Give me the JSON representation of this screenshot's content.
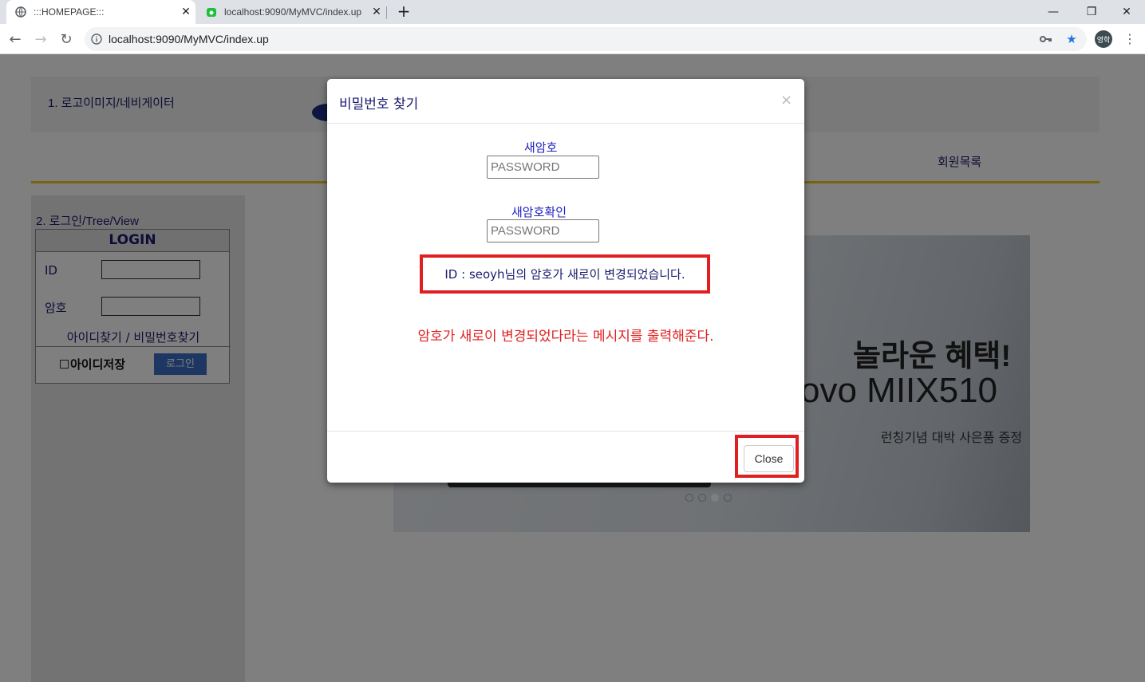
{
  "browser": {
    "tabs": [
      {
        "title": ":::HOMEPAGE:::",
        "active": true
      },
      {
        "title": "localhost:9090/MyMVC/index.up",
        "active": false
      }
    ],
    "url": "localhost:9090/MyMVC/index.up",
    "profile_initials": "영학"
  },
  "page": {
    "header_label": "1. 로고이미지/네비게이터",
    "nav_item": "회원목록",
    "left_label": "2. 로그인/Tree/View",
    "login": {
      "title": "LOGIN",
      "id_label": "ID",
      "pw_label": "암호",
      "find_id": "아이디찾기",
      "separator": "/",
      "find_pw": "비밀번호찾기",
      "save_id": "아이디저장",
      "login_button": "로그인"
    },
    "banner": {
      "headline": "놀라운 혜택!",
      "model": "ovo MIIX510",
      "sub": "런칭기념 대박 사은품 증정"
    }
  },
  "modal": {
    "title": "비밀번호 찾기",
    "close_x": "×",
    "new_pw_label": "새암호",
    "new_pw_placeholder": "PASSWORD",
    "confirm_pw_label": "새암호확인",
    "confirm_pw_placeholder": "PASSWORD",
    "result_message": "ID : seoyh님의 암호가 새로이 변경되었습니다.",
    "annotation": "암호가 새로이 변경되었다라는 메시지를 출력해준다.",
    "close_button": "Close"
  },
  "colors": {
    "highlight": "#e02020",
    "navy_text": "#1a1a6e",
    "accent_line": "#f0c419",
    "login_button": "#3a6cc4"
  }
}
